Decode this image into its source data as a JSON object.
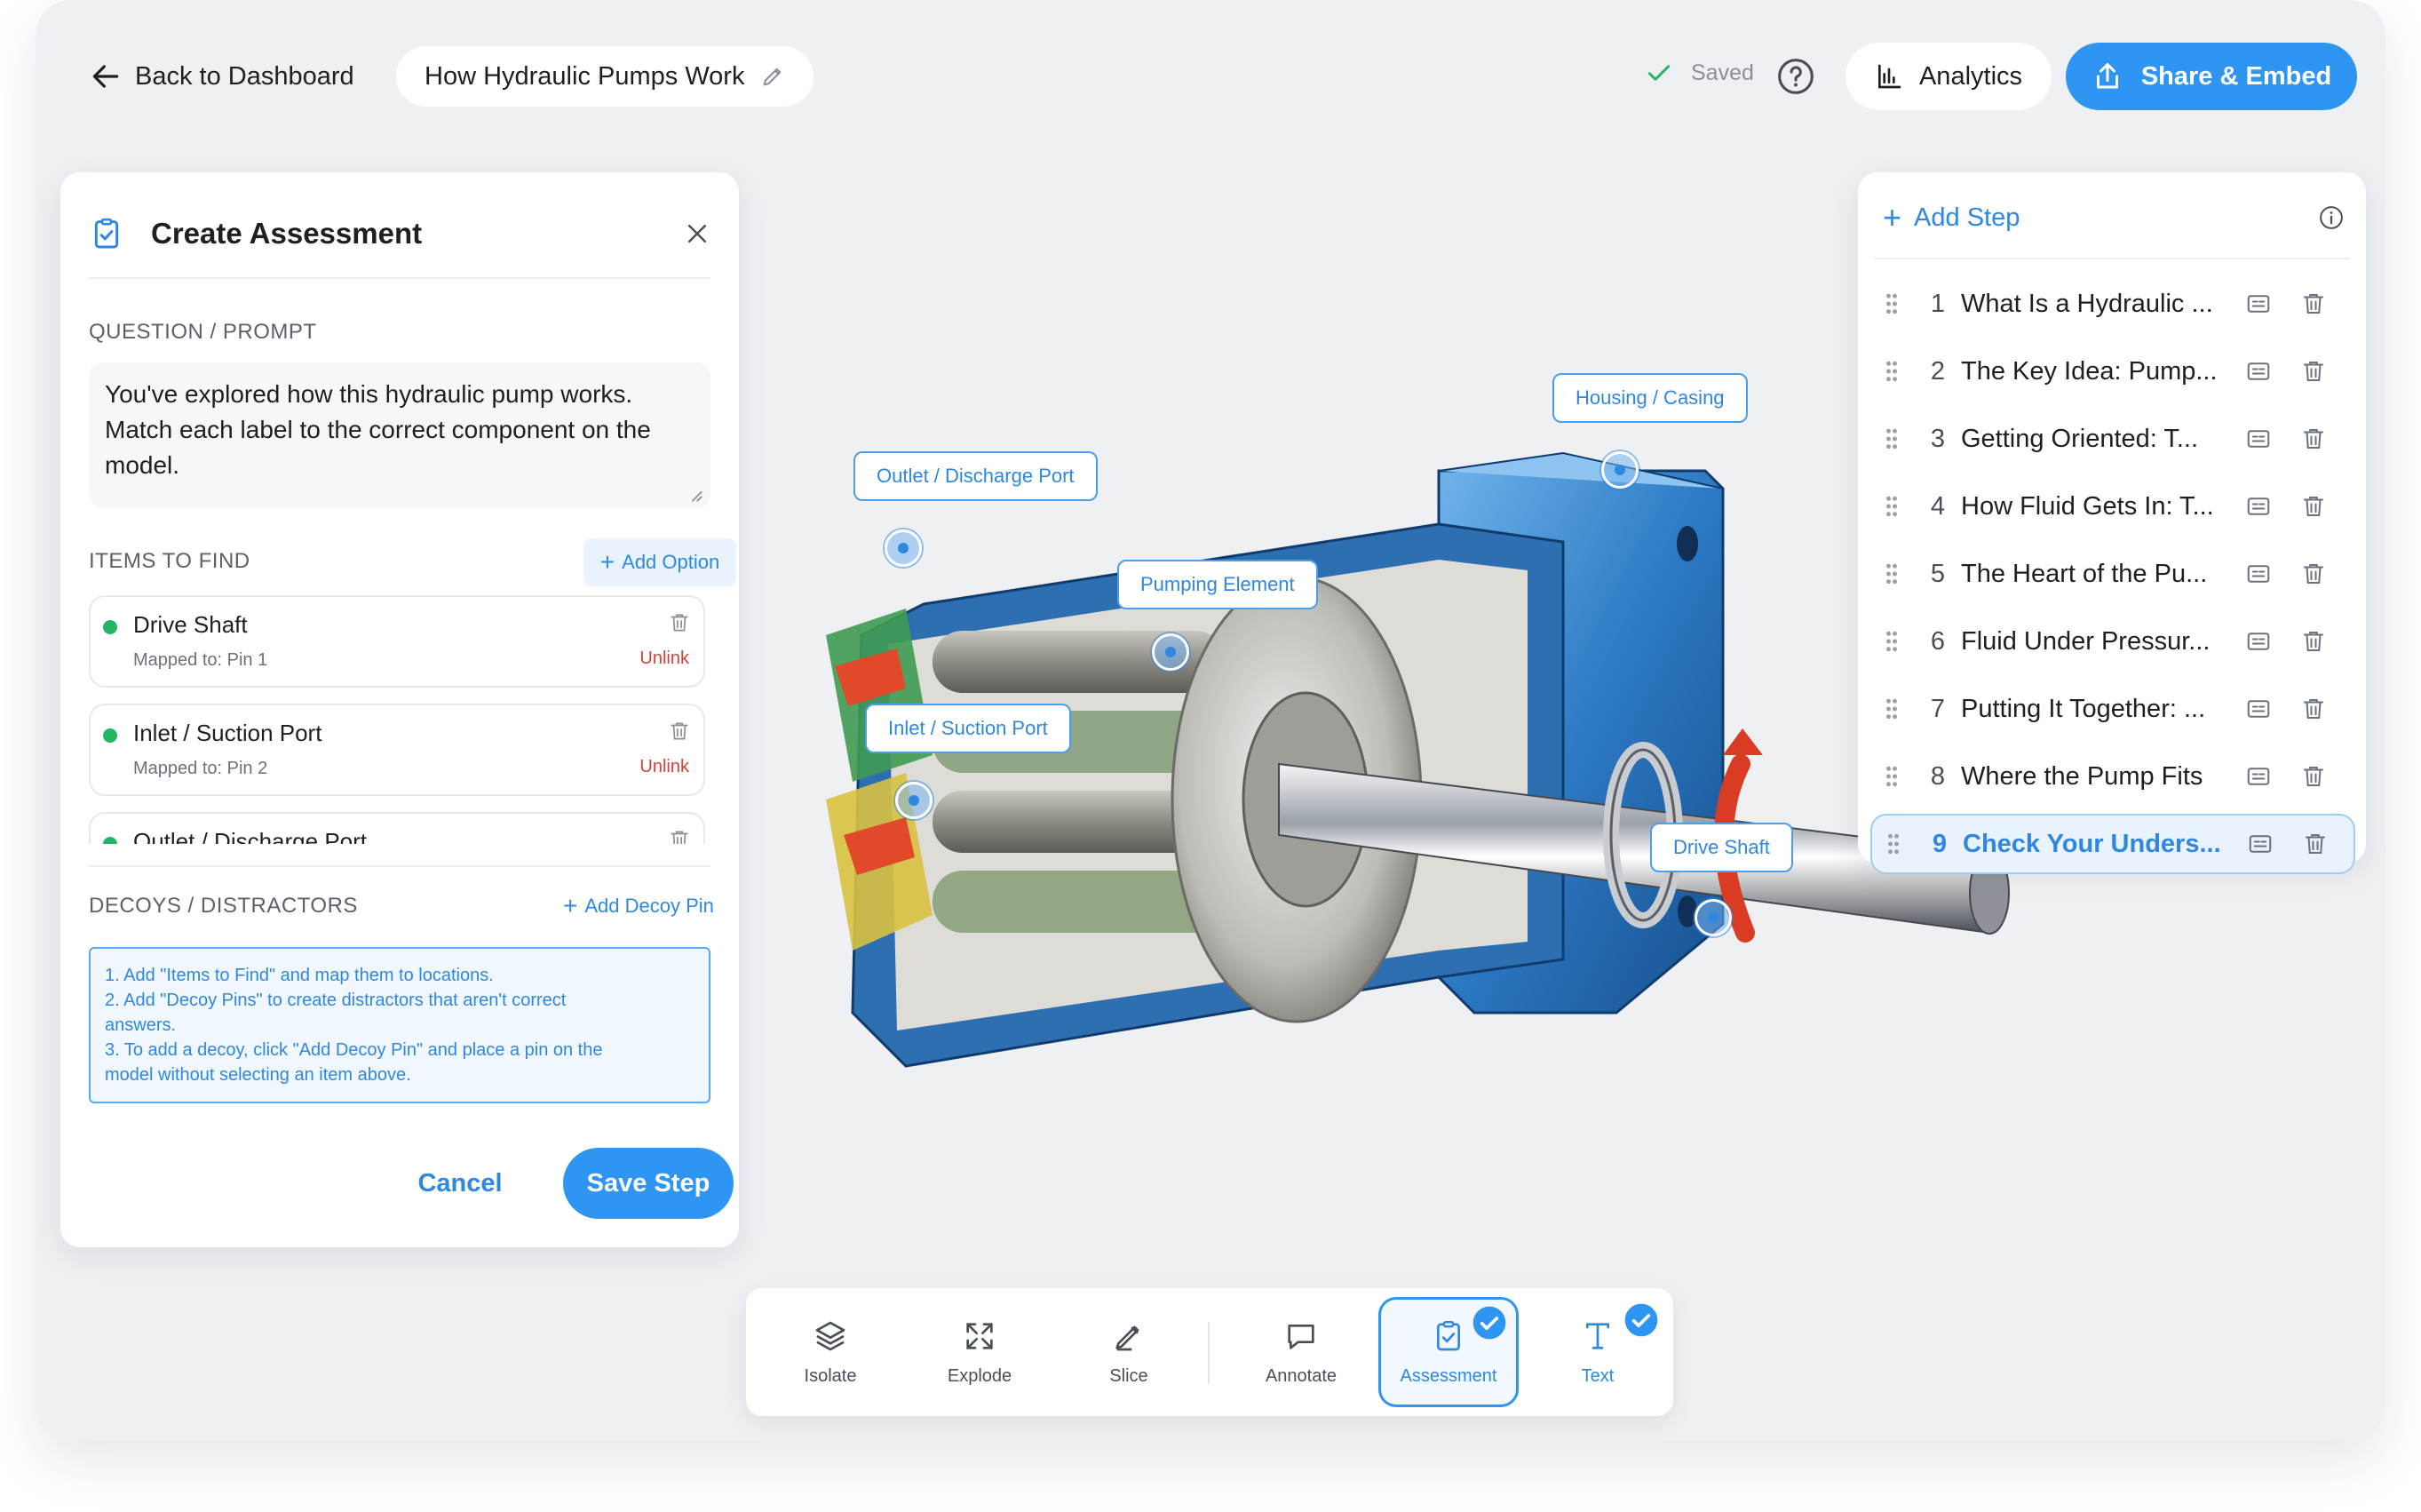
{
  "header": {
    "back_label": "Back to Dashboard",
    "project_title": "How Hydraulic Pumps Work",
    "saved_label": "Saved",
    "analytics_label": "Analytics",
    "share_label": "Share & Embed"
  },
  "assessment": {
    "title": "Create Assessment",
    "question_label": "QUESTION / PROMPT",
    "question_text": "You've explored how this hydraulic pump works. Match each label to the correct component on the model.",
    "items_label": "ITEMS TO FIND",
    "add_option_label": "Add Option",
    "items": [
      {
        "name": "Drive Shaft",
        "mapped": "Mapped to: Pin 1",
        "unlink": "Unlink"
      },
      {
        "name": "Inlet / Suction Port",
        "mapped": "Mapped to: Pin 2",
        "unlink": "Unlink"
      },
      {
        "name": "Outlet / Discharge Port",
        "mapped": "",
        "unlink": ""
      }
    ],
    "decoys_label": "DECOYS / DISTRACTORS",
    "add_decoy_label": "Add Decoy Pin",
    "instructions": [
      "1. Add \"Items to Find\" and map them to locations.",
      "2. Add \"Decoy Pins\" to create distractors that aren't correct",
      "answers.",
      "3. To add a decoy, click \"Add Decoy Pin\" and place a pin on the",
      "model without selecting an item above."
    ],
    "cancel_label": "Cancel",
    "save_label": "Save Step"
  },
  "model": {
    "labels": {
      "housing": "Housing / Casing",
      "outlet": "Outlet / Discharge Port",
      "pumping": "Pumping Element",
      "inlet": "Inlet / Suction Port",
      "drive_shaft": "Drive Shaft"
    }
  },
  "toolbar": {
    "tools": [
      {
        "label": "Isolate",
        "icon": "layers-icon"
      },
      {
        "label": "Explode",
        "icon": "expand-arrows-icon"
      },
      {
        "label": "Slice",
        "icon": "pen-icon"
      },
      {
        "label": "Annotate",
        "icon": "speech-bubble-icon"
      },
      {
        "label": "Assessment",
        "icon": "clipboard-check-icon"
      },
      {
        "label": "Text",
        "icon": "text-T-icon"
      }
    ]
  },
  "steps": {
    "add_label": "Add Step",
    "items": [
      {
        "num": "1",
        "title": "What Is a Hydraulic ..."
      },
      {
        "num": "2",
        "title": "The Key Idea: Pump..."
      },
      {
        "num": "3",
        "title": "Getting Oriented: T..."
      },
      {
        "num": "4",
        "title": "How Fluid Gets In: T..."
      },
      {
        "num": "5",
        "title": "The Heart of the Pu..."
      },
      {
        "num": "6",
        "title": "Fluid Under Pressur..."
      },
      {
        "num": "7",
        "title": "Putting It Together: ..."
      },
      {
        "num": "8",
        "title": "Where the Pump Fits"
      },
      {
        "num": "9",
        "title": "Check Your Unders..."
      }
    ],
    "active_index": 9
  },
  "colors": {
    "accent": "#2f95f3",
    "link": "#2f87e0",
    "danger": "#d2413b",
    "success": "#23b464",
    "background": "#eef0f3"
  }
}
